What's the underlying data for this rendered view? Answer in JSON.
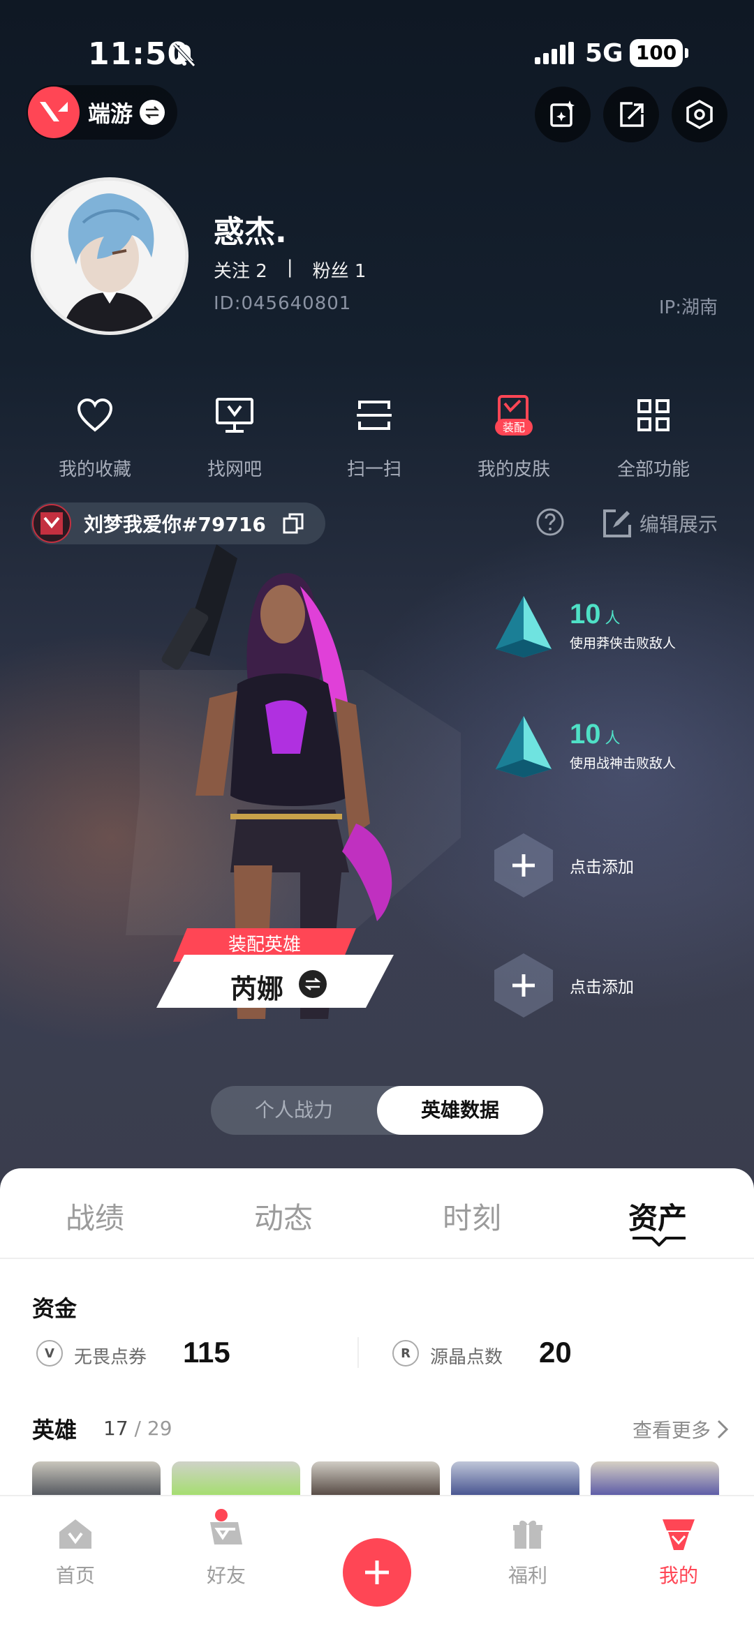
{
  "status": {
    "time": "11:50",
    "network": "5G",
    "battery": "100"
  },
  "header": {
    "app_name": "端游"
  },
  "profile": {
    "nickname": "惑杰.",
    "follow_label": "关注 2",
    "separator": "|",
    "fans_label": "粉丝 1",
    "id_text": "ID:045640801",
    "ip_text": "IP:湖南"
  },
  "quick_actions": [
    {
      "label": "我的收藏",
      "icon": "heart-icon"
    },
    {
      "label": "找网吧",
      "icon": "monitor-icon"
    },
    {
      "label": "扫一扫",
      "icon": "scan-icon"
    },
    {
      "label": "我的皮肤",
      "icon": "skin-icon",
      "badge": "装配"
    },
    {
      "label": "全部功能",
      "icon": "grid-icon"
    }
  ],
  "riot": {
    "name": "刘梦我爱你#79716",
    "edit_label": "编辑展示"
  },
  "hero": {
    "equip_label": "装配英雄",
    "name": "芮娜"
  },
  "achievements": [
    {
      "count": "10",
      "unit": "人",
      "desc": "使用莽侠击败敌人"
    },
    {
      "count": "10",
      "unit": "人",
      "desc": "使用战神击败敌人"
    }
  ],
  "add_slots": [
    "点击添加",
    "点击添加"
  ],
  "toggle": {
    "left": "个人战力",
    "right": "英雄数据"
  },
  "tabs": [
    "战绩",
    "动态",
    "时刻",
    "资产"
  ],
  "assets": {
    "funds_title": "资金",
    "fund1": {
      "label": "无畏点券",
      "value": "115"
    },
    "fund2": {
      "label": "源晶点数",
      "value": "20"
    },
    "heroes_title": "英雄",
    "heroes_owned": "17",
    "heroes_total": "/ 29",
    "see_more": "查看更多"
  },
  "nav": [
    "首页",
    "好友",
    "福利",
    "我的"
  ],
  "colors": {
    "accent": "#ff4655",
    "badge_teal": "#4fe0c6"
  }
}
